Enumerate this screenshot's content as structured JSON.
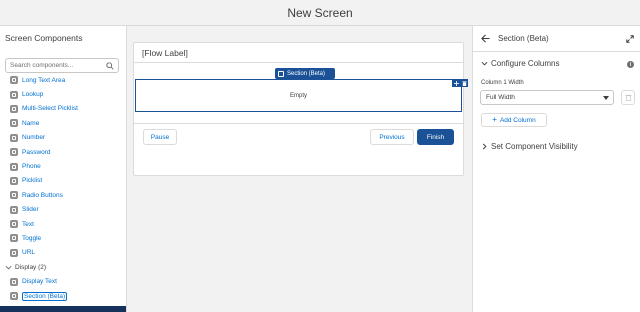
{
  "header": {
    "title": "New Screen"
  },
  "left_panel": {
    "title": "Screen Components",
    "search": {
      "placeholder": "Search components..."
    },
    "items": [
      {
        "label": "Long Text Area",
        "icon": "long-text-area-icon"
      },
      {
        "label": "Lookup",
        "icon": "lookup-icon"
      },
      {
        "label": "Multi-Select Picklist",
        "icon": "multi-select-picklist-icon"
      },
      {
        "label": "Name",
        "icon": "name-icon"
      },
      {
        "label": "Number",
        "icon": "number-icon"
      },
      {
        "label": "Password",
        "icon": "password-icon"
      },
      {
        "label": "Phone",
        "icon": "phone-icon"
      },
      {
        "label": "Picklist",
        "icon": "picklist-icon"
      },
      {
        "label": "Radio Buttons",
        "icon": "radio-buttons-icon"
      },
      {
        "label": "Slider",
        "icon": "slider-icon"
      },
      {
        "label": "Text",
        "icon": "text-icon"
      },
      {
        "label": "Toggle",
        "icon": "toggle-icon"
      },
      {
        "label": "URL",
        "icon": "url-icon"
      }
    ],
    "display_section": {
      "label": "Display (2)",
      "items": [
        {
          "label": "Display Text",
          "icon": "display-text-icon"
        },
        {
          "label": "Section (Beta)",
          "icon": "section-icon"
        }
      ]
    }
  },
  "canvas": {
    "flow_label": "[Flow Label]",
    "section_tag": "Section (Beta)",
    "empty_text": "Empty",
    "pause_label": "Pause",
    "previous_label": "Previous",
    "finish_label": "Finish"
  },
  "right_panel": {
    "title": "Section (Beta)",
    "configure_columns": "Configure Columns",
    "column_label": "Column 1 Width",
    "column_width": "Full Width",
    "add_column_label": "Add Column",
    "visibility_label": "Set Component Visibility"
  },
  "colors": {
    "brand": "#1b5297",
    "link": "#0070d2",
    "canvas_bg": "#f3f2f2",
    "selected_bar": "#16325c"
  }
}
